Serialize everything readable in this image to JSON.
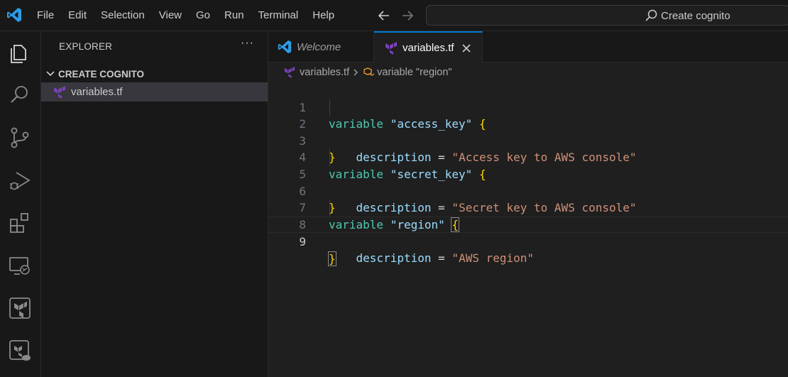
{
  "menu": [
    "File",
    "Edit",
    "Selection",
    "View",
    "Go",
    "Run",
    "Terminal",
    "Help"
  ],
  "search": {
    "label": "Create cognito"
  },
  "sidebar": {
    "title": "EXPLORER",
    "more": "···",
    "folder": "CREATE COGNITO",
    "files": [
      {
        "name": "variables.tf",
        "icon": "terraform-icon"
      }
    ]
  },
  "tabs": [
    {
      "label": "Welcome",
      "icon": "vscode-icon",
      "active": false
    },
    {
      "label": "variables.tf",
      "icon": "terraform-icon",
      "active": true
    }
  ],
  "breadcrumb": {
    "file": "variables.tf",
    "symbol": "variable \"region\""
  },
  "editor": {
    "current_line": 9,
    "lines": [
      {
        "n": "1",
        "kw": "variable",
        "name": "access_key"
      },
      {
        "n": "2",
        "attr": "description",
        "value": "Access key to AWS console"
      },
      {
        "n": "3",
        "close": "}"
      },
      {
        "n": "4",
        "kw": "variable",
        "name": "secret_key"
      },
      {
        "n": "5",
        "attr": "description",
        "value": "Secret key to AWS console"
      },
      {
        "n": "6",
        "close": "}"
      },
      {
        "n": "7",
        "kw": "variable",
        "name": "region"
      },
      {
        "n": "8",
        "attr": "description",
        "value": "AWS region"
      },
      {
        "n": "9",
        "close": "}"
      }
    ]
  },
  "colors": {
    "keyword": "#4ec9b0",
    "string": "#ce9178",
    "attribute": "#9cdcfe",
    "bracket": "#ffd700",
    "accent": "#0078d4",
    "terraform": "#7b42bc"
  }
}
